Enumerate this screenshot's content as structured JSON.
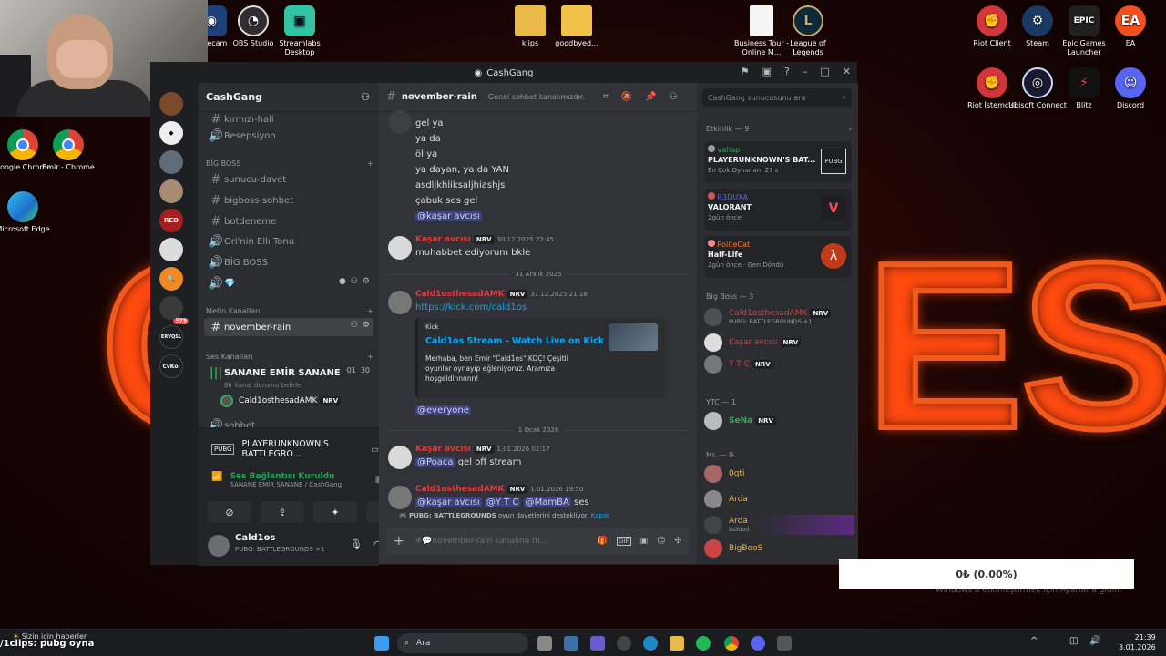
{
  "desktop": {
    "left_icons": [
      {
        "label": "Google Chrome",
        "icon": "chrome-icon"
      },
      {
        "label": "Emir - Chrome",
        "icon": "chrome-icon"
      },
      {
        "label": "Microsoft Edge",
        "icon": "edge-icon"
      }
    ],
    "top_icons": [
      {
        "label": "un ecam",
        "icon": "webcam-app-icon"
      },
      {
        "label": "OBS Studio",
        "icon": "obs-icon"
      },
      {
        "label": "Streamlabs Desktop",
        "icon": "streamlabs-icon"
      },
      {
        "label": "klips",
        "icon": "folder-icon"
      },
      {
        "label": "goodbyed...",
        "icon": "folder-icon"
      },
      {
        "label": "Business Tour - Online M...",
        "icon": "document-icon"
      },
      {
        "label": "League of Legends",
        "icon": "lol-icon"
      }
    ],
    "right_icons": [
      {
        "label": "Riot Client",
        "icon": "riot-icon"
      },
      {
        "label": "Steam",
        "icon": "steam-icon"
      },
      {
        "label": "Epic Games Launcher",
        "icon": "epic-icon"
      },
      {
        "label": "EA",
        "icon": "ea-icon"
      },
      {
        "label": "Riot İstemcisi",
        "icon": "riot-icon"
      },
      {
        "label": "Ubisoft Connect",
        "icon": "ubisoft-icon"
      },
      {
        "label": "Blitz",
        "icon": "blitz-icon"
      },
      {
        "label": "Discord",
        "icon": "discord-icon"
      }
    ]
  },
  "window": {
    "title": "CashGang",
    "server_name": "CashGang",
    "server_badges": [
      {
        "text": "579"
      },
      {
        "text": "ERVQSL"
      },
      {
        "text": "CvKöl"
      }
    ],
    "channels": {
      "top": [
        {
          "name": "kırmızı-hali"
        },
        {
          "name": "Resepsiyon"
        }
      ],
      "category_bigboss": "BİG BOSS",
      "bigboss": [
        {
          "name": "sunucu-davet"
        },
        {
          "name": "bigboss-sohbet"
        },
        {
          "name": "botdeneme"
        },
        {
          "name": "Gri'nin Ellı Tonu"
        },
        {
          "name": "BİG BOSS"
        },
        {
          "name": "💎"
        }
      ],
      "category_metin": "Metin Kanalları",
      "active_channel": "november-rain",
      "category_ses": "Ses Kanalları",
      "voice_channel": "SANANE EMİR SANANE",
      "voice_counts": [
        "01",
        "30"
      ],
      "voice_status": "Bir kanal durumu belirle",
      "voice_user": "Cald1osthesadAMK",
      "voice_user_badge": "NRV",
      "next_channel": "sohbet"
    },
    "activity_panel": {
      "game": "PLAYERUNKNOWN'S BATTLEGRO..."
    },
    "voice_panel": {
      "status": "Ses Bağlantısı Kuruldu",
      "detail": "SANANE EMİR SANANE / CashGang"
    },
    "user": {
      "name": "Cald1os",
      "status": "PUBG: BATTLEGROUNDS +1"
    },
    "chat_header": {
      "channel": "november-rain",
      "topic": "Genel sohbet kanalımızdır."
    },
    "search_placeholder": "CashGang sunucusunu ara",
    "messages": {
      "block1_lines": [
        "gel ya",
        "ya da",
        "öl ya",
        "ya dayan, ya da YAN",
        "asdljkhliksaljhiashjs",
        "çabuk ses gel"
      ],
      "block1_mention": "@kaşar avcısı",
      "m2_user": "Kaşar avcısı",
      "m2_badge": "NRV",
      "m2_time": "30.12.2025 22:45",
      "m2_text": "muhabbet ediyorum bkle",
      "divider1": "31 Aralık 2025",
      "m3_user": "Cald1osthesadAMK",
      "m3_badge": "NRV",
      "m3_time": "31.12.2025 21:18",
      "m3_link": "https://kick.com/cald1os",
      "embed_provider": "Kick",
      "embed_title": "Cald1os Stream - Watch Live on Kick",
      "embed_desc": "Merhaba, ben Emir \"Cald1os\" KOÇ! Çeşitli oyunlar oynayıp eğleniyoruz. Aramıza hoşgeldinnnnn!",
      "m3_everyone": "@everyone",
      "divider2": "1 Ocak 2026",
      "m4_user": "Kaşar avcısı",
      "m4_badge": "NRV",
      "m4_time": "1.01.2026 02:17",
      "m4_mention": "@Poaca",
      "m4_text": "gel off stream",
      "m5_user": "Cald1osthesadAMK",
      "m5_badge": "NRV",
      "m5_time": "1.01.2026 19:50",
      "m5_mentions": [
        "@kaşar avcısı",
        "@Y T C",
        "@MamBA"
      ],
      "m5_text": "ses",
      "invite_notice": "PUBG: BATTLEGROUNDS",
      "invite_suffix": "oyun davetlerini destekliyor.",
      "invite_close": "Kapat"
    },
    "composer_placeholder": "#💬november-rain kanalına m..."
  },
  "members": {
    "activity_header": "Etkinlik — 9",
    "activities": [
      {
        "user": "vahap",
        "game": "PLAYERUNKNOWN'S BAT...",
        "detail": "En Çok Oynanan: 27 s",
        "color": "#3ba55c",
        "tile": "PUBG"
      },
      {
        "user": "R3DUXA",
        "game": "VALORANT",
        "detail": "2gün önce",
        "color": "#5865f2",
        "tile": "V"
      },
      {
        "user": "PoliteCat",
        "game": "Half-Life",
        "detail": "2gün önce · Geri Döndü",
        "color": "#f57731",
        "tile": "λ"
      }
    ],
    "groups": [
      {
        "header": "Big Boss — 3",
        "members": [
          {
            "name": "Cald1osthesadAMK",
            "badge": "NRV",
            "sub": "PUBG: BATTLEGROUNDS +1",
            "color": "#e23b3b"
          },
          {
            "name": "Kaşar avcısı",
            "badge": "NRV",
            "sub": "",
            "color": "#e23b3b"
          },
          {
            "name": "Y T C",
            "badge": "NRV",
            "sub": "",
            "color": "#e23b3b"
          }
        ]
      },
      {
        "header": "YTC — 1",
        "members": [
          {
            "name": "SeNa",
            "badge": "NRV",
            "sub": "",
            "color": "#3ba55c"
          }
        ]
      },
      {
        "header": "Mr. — 9",
        "members": [
          {
            "name": "0qti",
            "badge": "",
            "sub": "",
            "color": "#f0b232"
          },
          {
            "name": "Arda",
            "badge": "",
            "sub": "",
            "color": "#f0b232"
          },
          {
            "name": "Arda",
            "badge": "",
            "sub": "isGood",
            "color": "#f0b232"
          },
          {
            "name": "BigBooS",
            "badge": "",
            "sub": "",
            "color": "#f0b232"
          }
        ]
      }
    ]
  },
  "taskbar": {
    "news": "Sizin için haberler",
    "overlay_text": "/1clips: pubg oyna",
    "search_placeholder": "Ara",
    "time": "21:39",
    "date": "3.01.2026"
  },
  "overlay": {
    "stat": "0₺ (0.00%)",
    "windows_activation": "Windows'u etkinleştirmek için Ayarlar'a gidin."
  }
}
